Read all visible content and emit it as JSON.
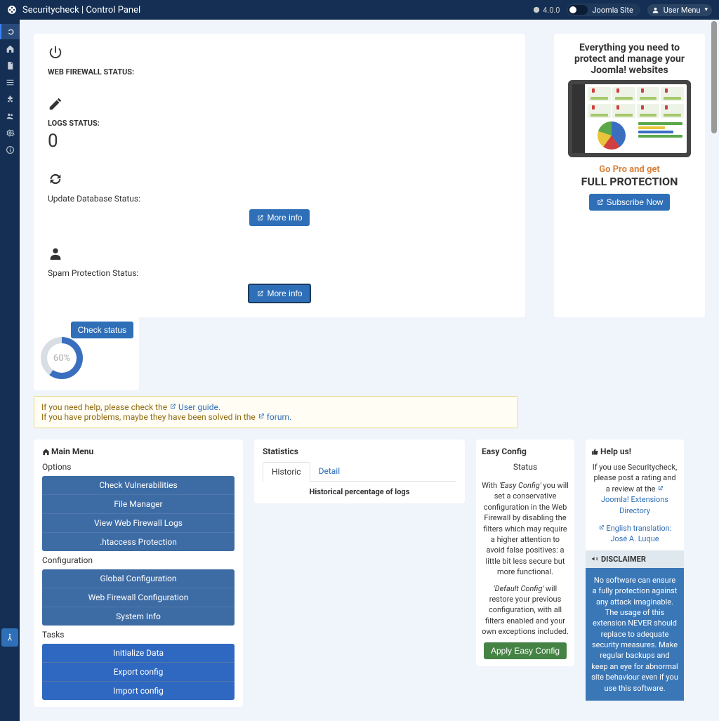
{
  "header": {
    "title": "Securitycheck | Control Panel",
    "version": "4.0.0",
    "site_label": "Joomla Site",
    "user_menu": "User Menu"
  },
  "status": {
    "firewall_label": "WEB FIREWALL STATUS:",
    "logs_label": "LOGS STATUS:",
    "logs_value": "0",
    "update_label": "Update Database Status:",
    "spam_label": "Spam Protection Status:",
    "more_info": "More info",
    "check_status": "Check status",
    "donut_percent": "60%"
  },
  "promo": {
    "title": "Everything you need to protect and manage your Joomla! websites",
    "go_pro": "Go Pro and get",
    "full": "FULL PROTECTION",
    "subscribe": "Subscribe Now"
  },
  "help": {
    "line1_a": "If you need help, please check the ",
    "link1": "User guide.",
    "line2_a": "If you have problems, maybe they have been solved in the ",
    "link2": "forum."
  },
  "mainmenu": {
    "title": "Main Menu",
    "options_label": "Options",
    "options": [
      "Check Vulnerabilities",
      "File Manager",
      "View Web Firewall Logs",
      ".htaccess Protection"
    ],
    "config_label": "Configuration",
    "config": [
      "Global Configuration",
      "Web Firewall Configuration",
      "System Info"
    ],
    "tasks_label": "Tasks",
    "tasks": [
      "Initialize Data",
      "Export config",
      "Import config"
    ]
  },
  "stats": {
    "title": "Statistics",
    "tab_historic": "Historic",
    "tab_detail": "Detail",
    "caption": "Historical percentage of logs"
  },
  "easyconfig": {
    "title": "Easy Config",
    "status": "Status",
    "p1_a": "With ",
    "p1_b": "'Easy Config'",
    "p1_c": " you will set a conservative configuration in the Web Firewall by disabling the filters which may require a higher attention to avoid false positives: a little bit less secure but more functional.",
    "p2_a": "'Default Config'",
    "p2_b": " will restore your previous configuration, with all filters enabled and your own exceptions included.",
    "apply": "Apply Easy Config"
  },
  "helpus": {
    "title": "Help us!",
    "p1": "If you use Securitycheck, please post a rating and a review at the ",
    "link_jed": "Joomla! Extensions Directory",
    "p2": "English translation: ",
    "translator": "José A. Luque",
    "disclaimer_title": "DISCLAIMER",
    "disclaimer_body": "No software can ensure a fully protection against any attack imaginable. The usage of this extension NEVER should replace to adequate security measures. Make regular backups and keep an eye for abnormal site behaviour even if you use this software."
  }
}
